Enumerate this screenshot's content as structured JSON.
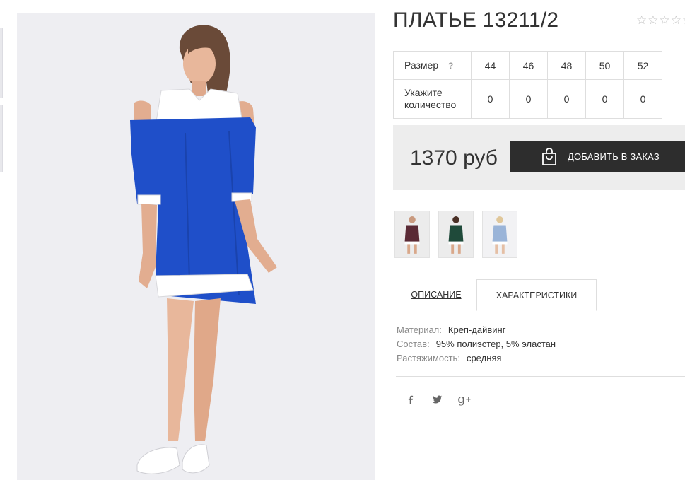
{
  "product": {
    "title": "ПЛАТЬЕ 13211/2",
    "rating": {
      "stars": 5,
      "filled": 0
    },
    "photo_icon": "woman-in-blue-dress-photo"
  },
  "size_table": {
    "size_label": "Размер",
    "help_label": "?",
    "qty_label_line1": "Укажите",
    "qty_label_line2": "количество",
    "sizes": [
      "44",
      "46",
      "48",
      "50",
      "52"
    ],
    "quantities": [
      "0",
      "0",
      "0",
      "0",
      "0"
    ]
  },
  "purchase": {
    "price": "1370 руб",
    "add_button_label": "ДОБАВИТЬ В ЗАКАЗ",
    "button_icon": "shopping-bag-icon"
  },
  "variants": [
    {
      "name": "burgundy-dress-variant",
      "color": "#5a2a35"
    },
    {
      "name": "green-dress-variant",
      "color": "#1f4a3a"
    },
    {
      "name": "lightblue-dress-variant",
      "color": "#9ab4d8"
    }
  ],
  "tabs": {
    "description": "ОПИСАНИЕ",
    "characteristics": "ХАРАКТЕРИСТИКИ",
    "active": "characteristics"
  },
  "specs": [
    {
      "key": "Материал:",
      "value": "Креп-дайвинг"
    },
    {
      "key": "Состав:",
      "value": "95% полиэстер, 5% эластан"
    },
    {
      "key": "Растяжимость:",
      "value": "средняя"
    }
  ],
  "social": [
    "facebook-icon",
    "twitter-icon",
    "google-plus-icon"
  ],
  "colors": {
    "dress_blue": "#1f4fc9",
    "button_bg": "#2d2d2d",
    "price_bar_bg": "#ededed"
  }
}
